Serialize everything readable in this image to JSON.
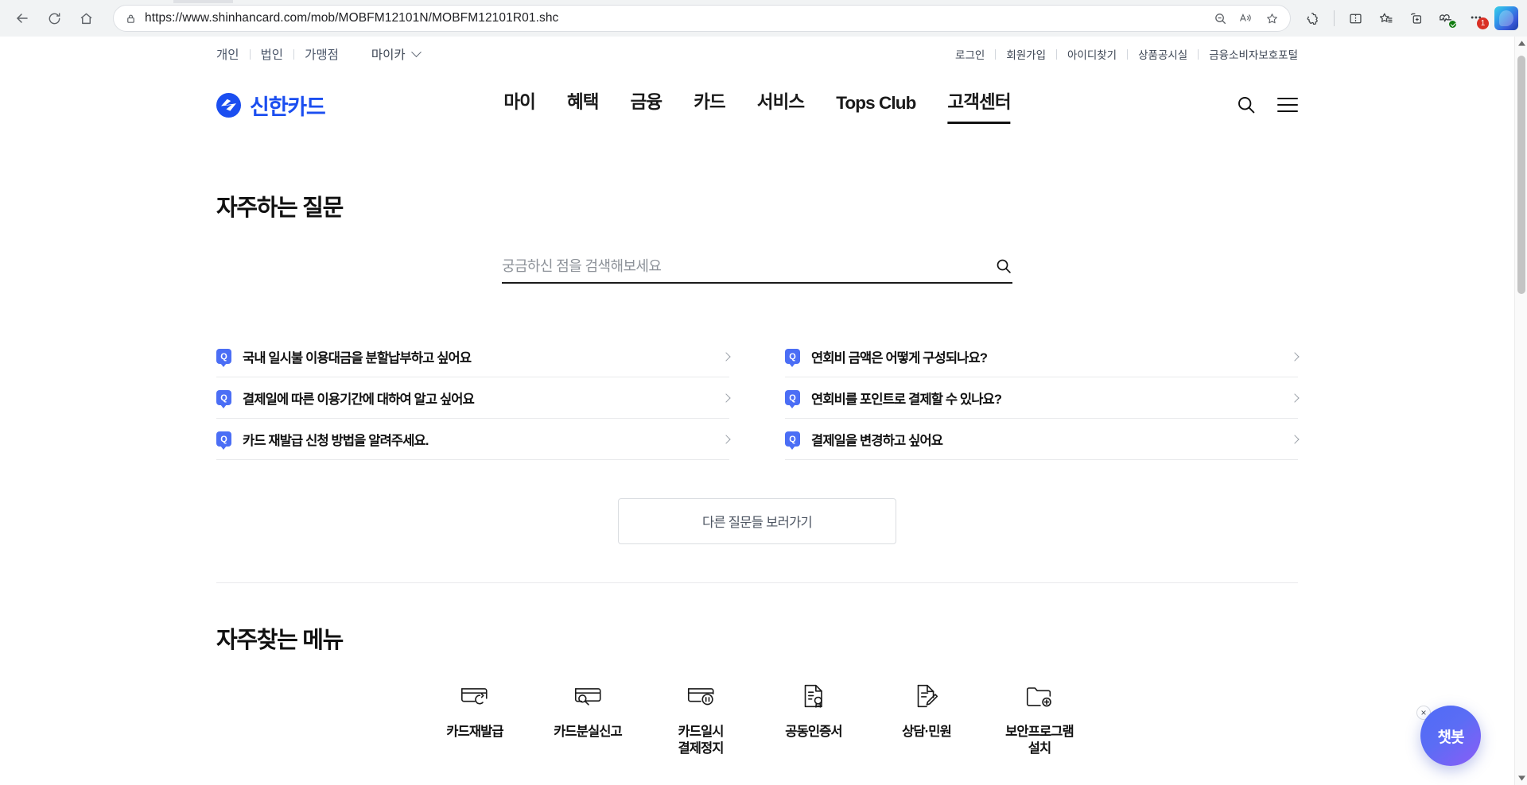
{
  "browser": {
    "url_scheme": "https://www.",
    "url_domain": "shinhancard.com",
    "url_path": "/mob/MOBFM12101N/MOBFM12101R01.shc",
    "url_full": "https://www.shinhancard.com/mob/MOBFM12101N/MOBFM12101R01.shc",
    "icons": {
      "back": "back-arrow-icon",
      "refresh": "refresh-icon",
      "home": "home-icon",
      "site_info": "site-info-lock-icon",
      "zoom_out": "zoom-out-icon",
      "read_aloud": "read-aloud-icon",
      "favorite": "favorite-star-icon",
      "extensions": "extensions-puzzle-icon",
      "split_screen": "split-screen-icon",
      "collections": "collections-icon",
      "add_tab_group": "add-tab-group-icon",
      "browser_essentials": "browser-essentials-icon",
      "settings_more": "settings-and-more-icon",
      "copilot": "copilot-icon"
    },
    "notification_count": "1"
  },
  "utility_nav": {
    "segments": [
      "개인",
      "법인",
      "가맹점"
    ],
    "mycar_label": "마이카",
    "links": [
      "로그인",
      "회원가입",
      "아이디찾기",
      "상품공시실",
      "금융소비자보호포털"
    ]
  },
  "header": {
    "logo_text": "신한카드",
    "nav": [
      {
        "label": "마이",
        "active": false
      },
      {
        "label": "혜택",
        "active": false
      },
      {
        "label": "금융",
        "active": false
      },
      {
        "label": "카드",
        "active": false
      },
      {
        "label": "서비스",
        "active": false
      },
      {
        "label": "Tops Club",
        "active": false
      },
      {
        "label": "고객센터",
        "active": true
      }
    ],
    "search_icon": "search-icon",
    "menu_icon": "hamburger-menu-icon"
  },
  "faq": {
    "title": "자주하는 질문",
    "search_placeholder": "궁금하신 점을 검색해보세요",
    "search_value": "",
    "badge": "Q",
    "left_items": [
      "국내 일시불 이용대금을 분할납부하고 싶어요",
      "결제일에 따른 이용기간에 대하여 알고 싶어요",
      "카드 재발급 신청 방법을 알려주세요."
    ],
    "right_items": [
      "연회비 금액은 어떻게 구성되나요?",
      "연회비를 포인트로 결제할 수 있나요?",
      "결제일을 변경하고 싶어요"
    ],
    "more_button": "다른 질문들 보러가기"
  },
  "quick_menu": {
    "title": "자주찾는 메뉴",
    "items": [
      {
        "label": "카드재발급",
        "icon": "card-reissue-icon"
      },
      {
        "label": "카드분실신고",
        "icon": "card-loss-report-icon"
      },
      {
        "label": "카드일시\n결제정지",
        "icon": "card-payment-pause-icon"
      },
      {
        "label": "공동인증서",
        "icon": "joint-certificate-icon"
      },
      {
        "label": "상담·민원",
        "icon": "consultation-complaint-icon"
      },
      {
        "label": "보안프로그램\n설치",
        "icon": "security-program-install-icon"
      }
    ]
  },
  "chatbot": {
    "label": "챗봇",
    "close_label": "×"
  },
  "colors": {
    "brand_blue": "#1b4ef0",
    "q_badge_blue": "#4b6ef5",
    "active_underline": "#111111",
    "chatbot_gradient_start": "#4f6bf6",
    "chatbot_gradient_end": "#8b5cf6"
  }
}
